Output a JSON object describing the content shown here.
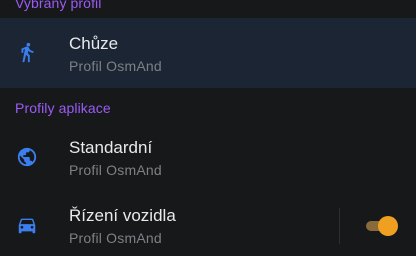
{
  "sections": {
    "selected_title": "Vybraný profil",
    "apps_title": "Profily aplikace"
  },
  "profiles": [
    {
      "title": "Chůze",
      "subtitle": "Profil OsmAnd",
      "icon": "walking-icon",
      "selected": true
    },
    {
      "title": "Standardní",
      "subtitle": "Profil OsmAnd",
      "icon": "globe-icon",
      "selected": false
    },
    {
      "title": "Řízení vozidla",
      "subtitle": "Profil OsmAnd",
      "icon": "car-icon",
      "selected": false,
      "enabled": true
    }
  ],
  "colors": {
    "background": "#17181a",
    "selected_row": "#1b2533",
    "section_title": "#9a5cf6",
    "icon": "#3b7ef0",
    "toggle_on": "#f0a020"
  }
}
